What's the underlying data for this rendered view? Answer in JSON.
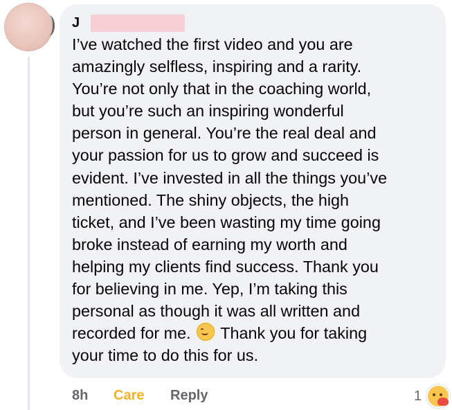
{
  "comment": {
    "author_initial": "J",
    "lines": [
      "I’ve watched the first video and you are",
      "amazingly selfless, inspiring and a rarity.",
      "You’re not only that in the coaching world,",
      "but you’re such an inspiring wonderful",
      "person in general. You’re the real deal and",
      "your passion for us to grow and succeed is",
      "evident. I’ve invested in all the things you’ve",
      "mentioned. The shiny objects, the high",
      "ticket, and I’ve been wasting my time going",
      "broke instead of earning my worth and",
      "helping my clients find success. Thank you",
      "for believing in me. Yep, I’m taking this",
      "personal as though it was all written and",
      "recorded for me.",
      "Thank you for taking",
      "your time to do this for us."
    ],
    "inline_emoji": "smiling-face-icon"
  },
  "actions": {
    "timestamp": "8h",
    "reaction_label": "Care",
    "reply_label": "Reply"
  },
  "reactions": {
    "count": "1",
    "icon": "care-reaction-icon"
  },
  "colors": {
    "bubble": "#f0f2f5",
    "care": "#f7b125",
    "muted": "#65676b",
    "text": "#050505"
  }
}
